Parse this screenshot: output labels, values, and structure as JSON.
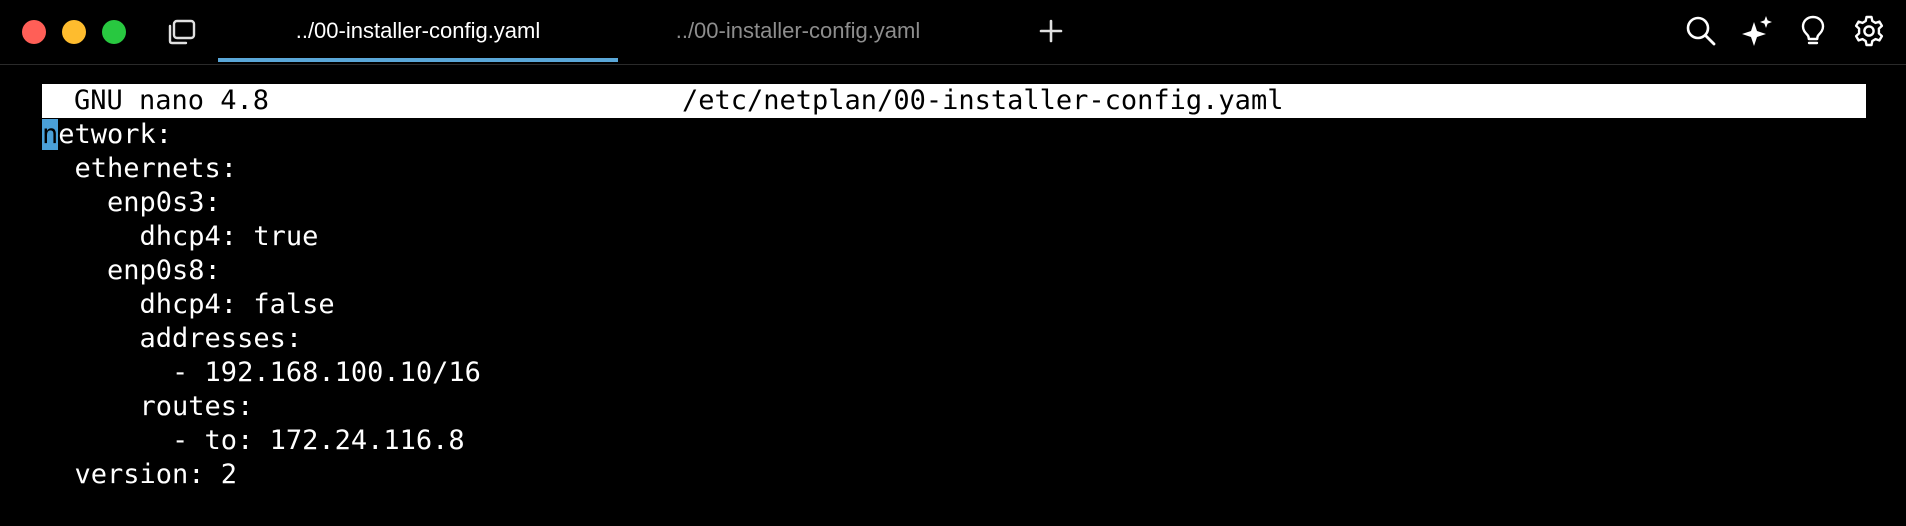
{
  "tabs": [
    {
      "label": "../00-installer-config.yaml",
      "active": true
    },
    {
      "label": "../00-installer-config.yaml",
      "active": false
    }
  ],
  "toolbar_icons": [
    "search-icon",
    "sparkles-icon",
    "lightbulb-icon",
    "gear-icon"
  ],
  "colors": {
    "close": "#ff5f57",
    "minimize": "#febc2e",
    "maximize": "#28c840",
    "active_tab_underline": "#5aa7d8",
    "cursor": "#4aa0d8"
  },
  "nano": {
    "version": "GNU nano 4.8",
    "file_path": "/etc/netplan/00-installer-config.yaml"
  },
  "editor": {
    "cursor_char": "n",
    "first_line_rest": "etwork:",
    "lines": [
      "  ethernets:",
      "    enp0s3:",
      "      dhcp4: true",
      "    enp0s8:",
      "      dhcp4: false",
      "      addresses:",
      "        - 192.168.100.10/16",
      "      routes:",
      "        - to: 172.24.116.8",
      "  version: 2"
    ]
  }
}
